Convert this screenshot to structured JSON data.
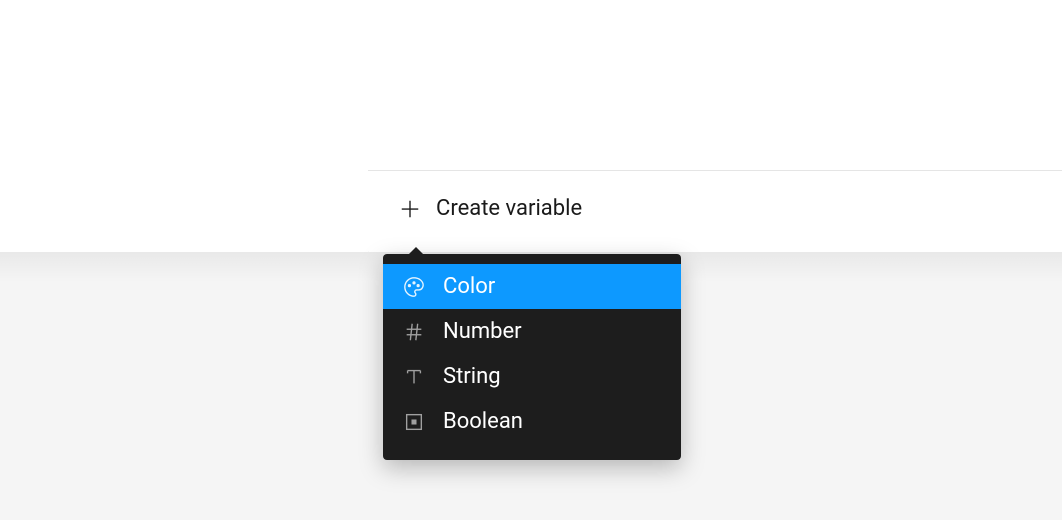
{
  "create_button": {
    "label": "Create variable"
  },
  "menu": {
    "items": [
      {
        "label": "Color",
        "icon": "palette-icon",
        "highlighted": true
      },
      {
        "label": "Number",
        "icon": "hash-icon",
        "highlighted": false
      },
      {
        "label": "String",
        "icon": "text-icon",
        "highlighted": false
      },
      {
        "label": "Boolean",
        "icon": "square-dot-icon",
        "highlighted": false
      }
    ]
  },
  "colors": {
    "highlight": "#0d99ff",
    "menu_bg": "#1d1d1d"
  }
}
